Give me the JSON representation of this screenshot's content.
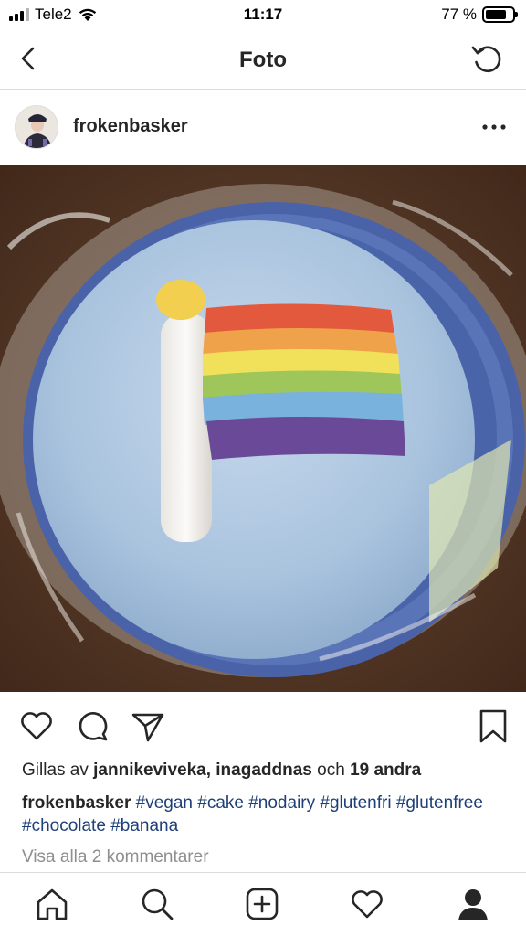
{
  "status_bar": {
    "carrier": "Tele2",
    "time": "11:17",
    "battery_percent": "77 %",
    "battery_level": 0.77,
    "signal_bars": 3,
    "wifi": "wifi-icon"
  },
  "nav": {
    "title": "Foto",
    "back_icon": "chevron-left-icon",
    "refresh_icon": "refresh-icon"
  },
  "post": {
    "username": "frokenbasker",
    "more_icon": "more-horizontal-icon",
    "photo_alt": "photo",
    "actions": [
      "heart-icon",
      "comment-icon",
      "share-icon",
      "bookmark-icon"
    ],
    "likes": {
      "prefix": "Gillas av",
      "users": "jannikeviveka, inagaddnas",
      "conj": "och",
      "others": "19 andra"
    },
    "caption": {
      "user": "frokenbasker",
      "tags": [
        "#vegan",
        "#cake",
        "#nodairy",
        "#glutenfri",
        "#glutenfree",
        "#chocolate",
        "#banana"
      ]
    },
    "view_comments": "Visa alla 2 kommentarer"
  },
  "tab_bar": [
    "home-icon",
    "search-icon",
    "add-post-icon",
    "activity-heart-icon",
    "profile-icon"
  ],
  "colors": {
    "text": "#262626",
    "hashtag": "#1e3f78",
    "muted": "#8e8e8e",
    "divider": "#dbdbdb"
  }
}
